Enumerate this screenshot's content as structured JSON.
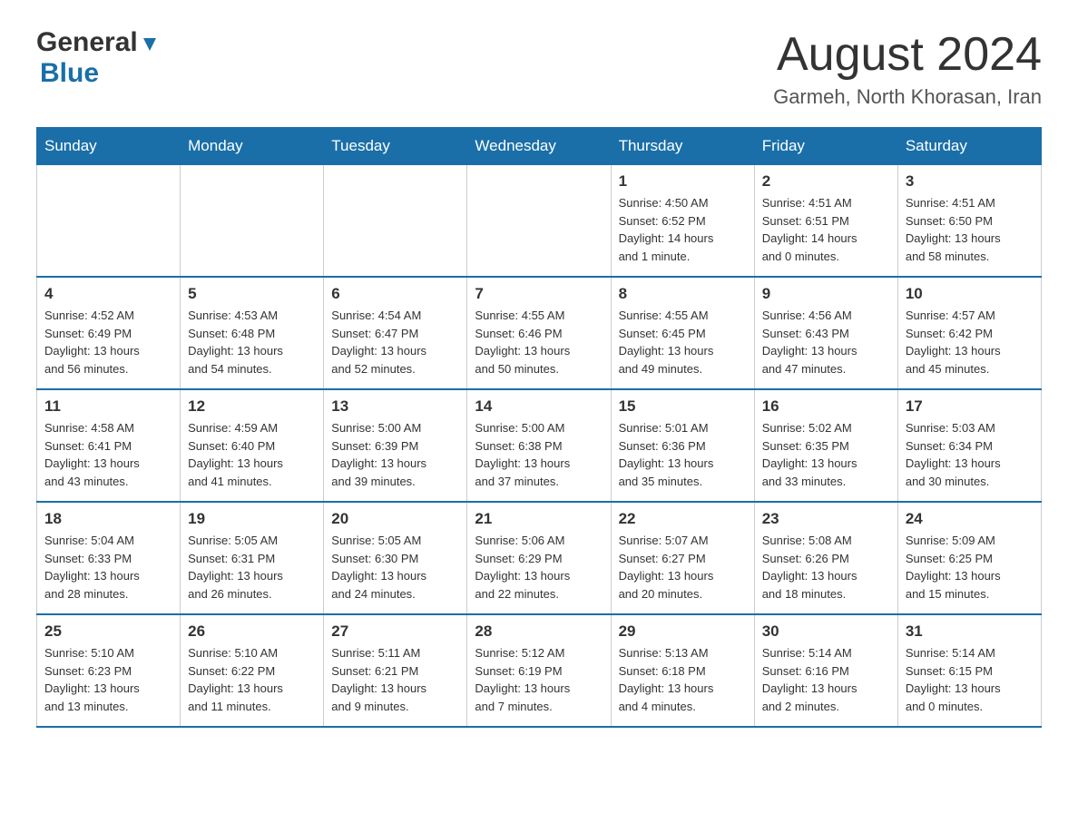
{
  "header": {
    "logo_general": "General",
    "logo_blue": "Blue",
    "month_title": "August 2024",
    "location": "Garmeh, North Khorasan, Iran"
  },
  "days_of_week": [
    "Sunday",
    "Monday",
    "Tuesday",
    "Wednesday",
    "Thursday",
    "Friday",
    "Saturday"
  ],
  "weeks": [
    [
      {
        "day": "",
        "info": ""
      },
      {
        "day": "",
        "info": ""
      },
      {
        "day": "",
        "info": ""
      },
      {
        "day": "",
        "info": ""
      },
      {
        "day": "1",
        "info": "Sunrise: 4:50 AM\nSunset: 6:52 PM\nDaylight: 14 hours\nand 1 minute."
      },
      {
        "day": "2",
        "info": "Sunrise: 4:51 AM\nSunset: 6:51 PM\nDaylight: 14 hours\nand 0 minutes."
      },
      {
        "day": "3",
        "info": "Sunrise: 4:51 AM\nSunset: 6:50 PM\nDaylight: 13 hours\nand 58 minutes."
      }
    ],
    [
      {
        "day": "4",
        "info": "Sunrise: 4:52 AM\nSunset: 6:49 PM\nDaylight: 13 hours\nand 56 minutes."
      },
      {
        "day": "5",
        "info": "Sunrise: 4:53 AM\nSunset: 6:48 PM\nDaylight: 13 hours\nand 54 minutes."
      },
      {
        "day": "6",
        "info": "Sunrise: 4:54 AM\nSunset: 6:47 PM\nDaylight: 13 hours\nand 52 minutes."
      },
      {
        "day": "7",
        "info": "Sunrise: 4:55 AM\nSunset: 6:46 PM\nDaylight: 13 hours\nand 50 minutes."
      },
      {
        "day": "8",
        "info": "Sunrise: 4:55 AM\nSunset: 6:45 PM\nDaylight: 13 hours\nand 49 minutes."
      },
      {
        "day": "9",
        "info": "Sunrise: 4:56 AM\nSunset: 6:43 PM\nDaylight: 13 hours\nand 47 minutes."
      },
      {
        "day": "10",
        "info": "Sunrise: 4:57 AM\nSunset: 6:42 PM\nDaylight: 13 hours\nand 45 minutes."
      }
    ],
    [
      {
        "day": "11",
        "info": "Sunrise: 4:58 AM\nSunset: 6:41 PM\nDaylight: 13 hours\nand 43 minutes."
      },
      {
        "day": "12",
        "info": "Sunrise: 4:59 AM\nSunset: 6:40 PM\nDaylight: 13 hours\nand 41 minutes."
      },
      {
        "day": "13",
        "info": "Sunrise: 5:00 AM\nSunset: 6:39 PM\nDaylight: 13 hours\nand 39 minutes."
      },
      {
        "day": "14",
        "info": "Sunrise: 5:00 AM\nSunset: 6:38 PM\nDaylight: 13 hours\nand 37 minutes."
      },
      {
        "day": "15",
        "info": "Sunrise: 5:01 AM\nSunset: 6:36 PM\nDaylight: 13 hours\nand 35 minutes."
      },
      {
        "day": "16",
        "info": "Sunrise: 5:02 AM\nSunset: 6:35 PM\nDaylight: 13 hours\nand 33 minutes."
      },
      {
        "day": "17",
        "info": "Sunrise: 5:03 AM\nSunset: 6:34 PM\nDaylight: 13 hours\nand 30 minutes."
      }
    ],
    [
      {
        "day": "18",
        "info": "Sunrise: 5:04 AM\nSunset: 6:33 PM\nDaylight: 13 hours\nand 28 minutes."
      },
      {
        "day": "19",
        "info": "Sunrise: 5:05 AM\nSunset: 6:31 PM\nDaylight: 13 hours\nand 26 minutes."
      },
      {
        "day": "20",
        "info": "Sunrise: 5:05 AM\nSunset: 6:30 PM\nDaylight: 13 hours\nand 24 minutes."
      },
      {
        "day": "21",
        "info": "Sunrise: 5:06 AM\nSunset: 6:29 PM\nDaylight: 13 hours\nand 22 minutes."
      },
      {
        "day": "22",
        "info": "Sunrise: 5:07 AM\nSunset: 6:27 PM\nDaylight: 13 hours\nand 20 minutes."
      },
      {
        "day": "23",
        "info": "Sunrise: 5:08 AM\nSunset: 6:26 PM\nDaylight: 13 hours\nand 18 minutes."
      },
      {
        "day": "24",
        "info": "Sunrise: 5:09 AM\nSunset: 6:25 PM\nDaylight: 13 hours\nand 15 minutes."
      }
    ],
    [
      {
        "day": "25",
        "info": "Sunrise: 5:10 AM\nSunset: 6:23 PM\nDaylight: 13 hours\nand 13 minutes."
      },
      {
        "day": "26",
        "info": "Sunrise: 5:10 AM\nSunset: 6:22 PM\nDaylight: 13 hours\nand 11 minutes."
      },
      {
        "day": "27",
        "info": "Sunrise: 5:11 AM\nSunset: 6:21 PM\nDaylight: 13 hours\nand 9 minutes."
      },
      {
        "day": "28",
        "info": "Sunrise: 5:12 AM\nSunset: 6:19 PM\nDaylight: 13 hours\nand 7 minutes."
      },
      {
        "day": "29",
        "info": "Sunrise: 5:13 AM\nSunset: 6:18 PM\nDaylight: 13 hours\nand 4 minutes."
      },
      {
        "day": "30",
        "info": "Sunrise: 5:14 AM\nSunset: 6:16 PM\nDaylight: 13 hours\nand 2 minutes."
      },
      {
        "day": "31",
        "info": "Sunrise: 5:14 AM\nSunset: 6:15 PM\nDaylight: 13 hours\nand 0 minutes."
      }
    ]
  ]
}
